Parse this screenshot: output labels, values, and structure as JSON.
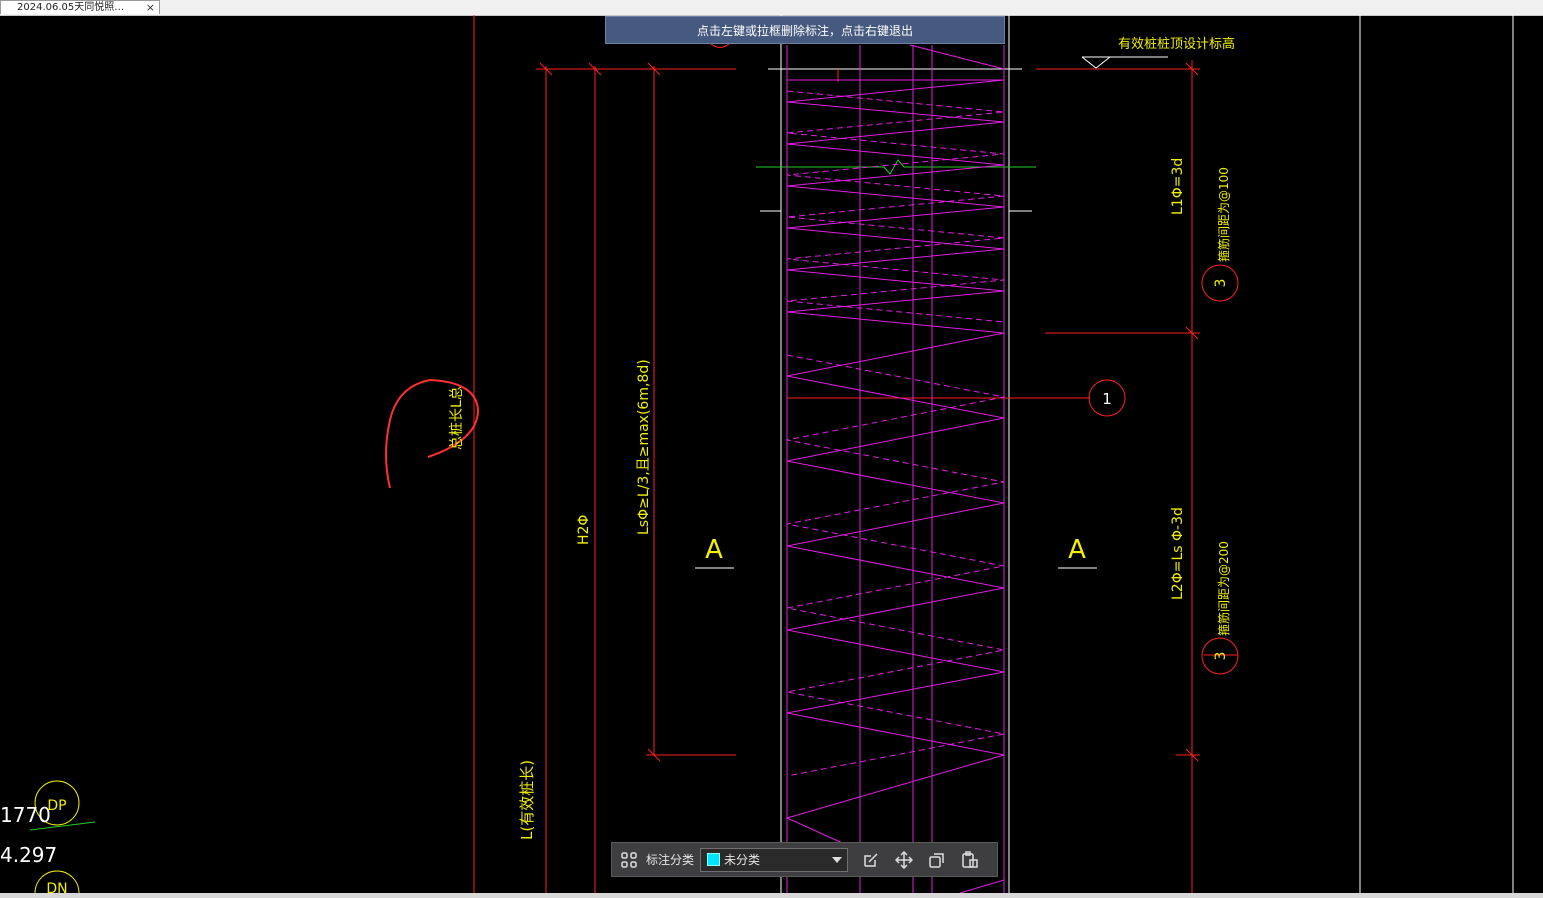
{
  "tab": {
    "title": "2024.06.05天同悦照…",
    "close": "×"
  },
  "tooltip": {
    "text": "点击左键或拉框删除标注，点击右键退出"
  },
  "drawing": {
    "top_label": "有效桩桩顶设计标高",
    "l1_label": "L1Φ=3d",
    "l2_label": "L2Φ=Ls Φ-3d",
    "spacing_100": "箍筋间距为@100",
    "spacing_200": "箍筋间距为@200",
    "circle_3": "3",
    "circle_1": "1",
    "section_a": "A",
    "ls_label": "LsΦ≥L/3,且≥max(6m,8d)",
    "h2_label": "H2Φ",
    "total_len": "总桩长L总",
    "eff_len": "L(有效桩长)",
    "left_num1": "1770",
    "left_num2": "4.297",
    "left_circle1": "DP",
    "left_circle2": "DN"
  },
  "toolbar": {
    "label": "标注分类",
    "selected": "未分类"
  },
  "colors": {
    "line_red": "#ff2020",
    "rebar": "#e020e0",
    "text_yellow": "#f0f000",
    "green": "#22cc22",
    "markup": "#ff3030",
    "swatch": "#00e5ff"
  }
}
